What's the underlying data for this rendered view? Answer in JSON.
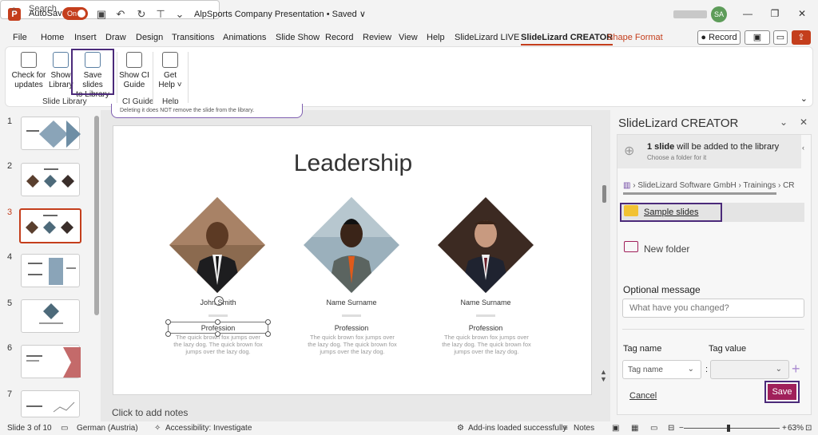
{
  "titlebar": {
    "autosave_label": "AutoSave",
    "autosave_state": "On",
    "document_title": "AlpSports Company Presentation • Saved ∨",
    "search_placeholder": "Search",
    "user_initials": "SA"
  },
  "tabs": [
    "File",
    "Home",
    "Insert",
    "Draw",
    "Design",
    "Transitions",
    "Animations",
    "Slide Show",
    "Record",
    "Review",
    "View",
    "Help",
    "SlideLizard LIVE",
    "SlideLizard CREATOR",
    "Shape Format"
  ],
  "active_tab": "SlideLizard CREATOR",
  "record_button": "Record",
  "ribbon": {
    "buttons": [
      {
        "label1": "Check for",
        "label2": "updates"
      },
      {
        "label1": "Show",
        "label2": "Library"
      },
      {
        "label1": "Save slides",
        "label2": "to Library"
      },
      {
        "label1": "Show CI",
        "label2": "Guide"
      },
      {
        "label1": "Get",
        "label2": "Help ˅"
      }
    ],
    "groups": [
      "Slide Library",
      "CI Guide",
      "Help"
    ]
  },
  "slides_panel": {
    "numbers": [
      "1",
      "2",
      "3",
      "4",
      "5",
      "6",
      "7"
    ],
    "active": "3"
  },
  "notice": "Deleting it does NOT remove the slide from the library.",
  "slide": {
    "title": "Leadership",
    "people": [
      {
        "name": "John Smith",
        "profession": "Profession",
        "desc": "The quick brown fox jumps over the lazy dog. The quick brown fox jumps over the lazy dog."
      },
      {
        "name": "Name Surname",
        "profession": "Profession",
        "desc": "The quick brown fox jumps over the lazy dog. The quick brown fox jumps over the lazy dog."
      },
      {
        "name": "Name Surname",
        "profession": "Profession",
        "desc": "The quick brown fox jumps over the lazy dog. The quick brown fox jumps over the lazy dog."
      }
    ]
  },
  "notes_placeholder": "Click to add notes",
  "pane": {
    "title": "SlideLizard CREATOR",
    "upload_count": "1 slide",
    "upload_text": " will be added to the library",
    "upload_sub": "Choose a folder for it",
    "breadcrumb": "› SlideLizard Software GmbH › Trainings › CR",
    "folder": "Sample slides",
    "new_folder": "New folder",
    "optional_label": "Optional message",
    "message_placeholder": "What have you changed?",
    "tag_name_label": "Tag name",
    "tag_value_label": "Tag value",
    "tag_name_placeholder": "Tag name",
    "cancel": "Cancel",
    "save": "Save"
  },
  "status": {
    "slide_info": "Slide 3 of 10",
    "language": "German (Austria)",
    "accessibility": "Accessibility: Investigate",
    "addins": "Add-ins loaded successfully",
    "notes": "Notes",
    "zoom": "63%"
  },
  "colors": {
    "accent": "#c43e1c",
    "highlight": "#4b2a7a",
    "save": "#a0205a"
  }
}
